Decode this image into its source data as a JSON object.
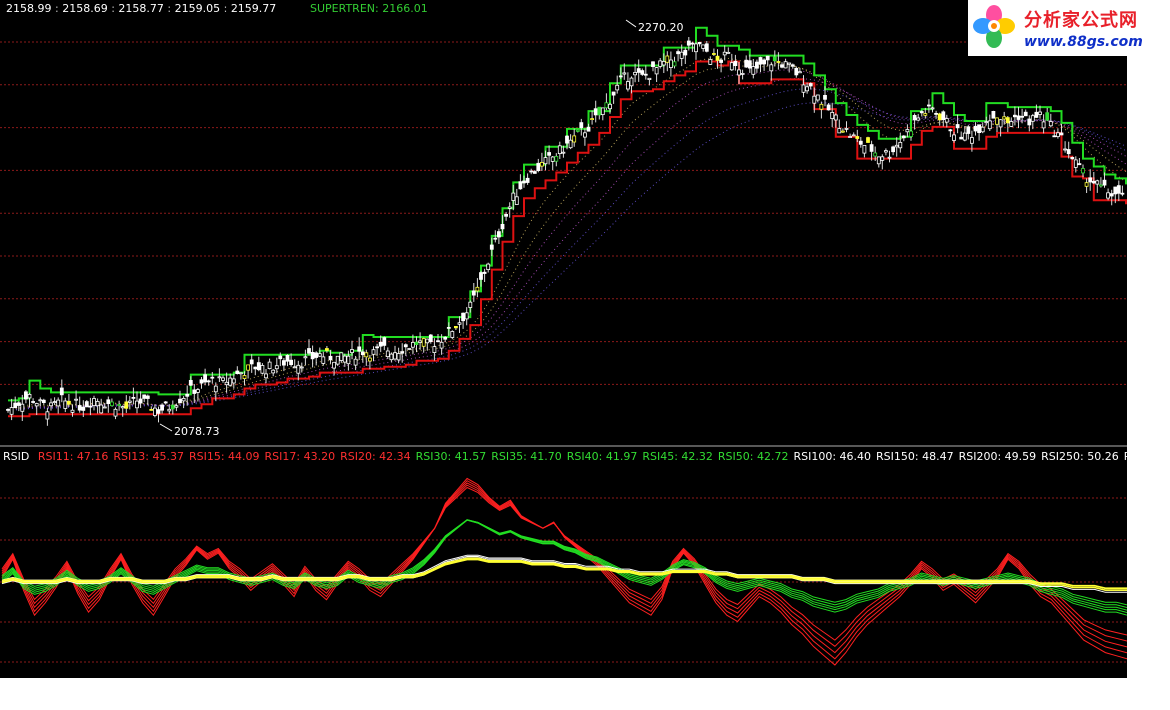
{
  "header": {
    "ohlc": [
      "2158.99",
      "2158.69",
      "2158.77",
      "2159.05",
      "2159.77"
    ],
    "ohlc_separator": " : ",
    "supertrend_label": "SUPERTREN: 2166.01"
  },
  "annotations": {
    "high": "2270.20",
    "low": "2078.73"
  },
  "rsi_panel": {
    "name_prefix": "RSID",
    "items": [
      {
        "label": "RSI11: 47.16",
        "color": "#ff3030"
      },
      {
        "label": "RSI13: 45.37",
        "color": "#ff3030"
      },
      {
        "label": "RSI15: 44.09",
        "color": "#ff3030"
      },
      {
        "label": "RSI17: 43.20",
        "color": "#ff3030"
      },
      {
        "label": "RSI20: 42.34",
        "color": "#ff3030"
      },
      {
        "label": "RSI30: 41.57",
        "color": "#33dd33"
      },
      {
        "label": "RSI35: 41.70",
        "color": "#33dd33"
      },
      {
        "label": "RSI40: 41.97",
        "color": "#33dd33"
      },
      {
        "label": "RSI45: 42.32",
        "color": "#33dd33"
      },
      {
        "label": "RSI50: 42.72",
        "color": "#33dd33"
      },
      {
        "label": "RSI100: 46.40",
        "color": "#ffffff"
      },
      {
        "label": "RSI150: 48.47",
        "color": "#ffffff"
      },
      {
        "label": "RSI200: 49.59",
        "color": "#ffffff"
      },
      {
        "label": "RSI250: 50.26",
        "color": "#ffffff"
      },
      {
        "label": "R",
        "color": "#ffffff"
      }
    ]
  },
  "logo": {
    "title": "分析家公式网",
    "url": "www.88gs.com"
  },
  "colors": {
    "background": "#000000",
    "gridline": "#8b1a1a",
    "up_candle": "#ffffff",
    "down_candle": "#ffffff",
    "strong_up": "#ffff33",
    "strong_down": "#33dd33",
    "supertrend_upper": "#22dd22",
    "supertrend_lower": "#dd1111",
    "ribbon": "#a040c0",
    "rsi_short": "#ff2020",
    "rsi_mid": "#22dd22",
    "rsi_long": "#ffffff",
    "rsi_longest": "#ffff33"
  },
  "chart_data": [
    {
      "type": "candlestick",
      "title": "",
      "ylim": [
        2068,
        2285
      ],
      "grid": true,
      "legend_position": "top-left",
      "close": [
        2083,
        2087,
        2090,
        2086,
        2084,
        2088,
        2086,
        2085,
        2089,
        2087,
        2086,
        2084,
        2088,
        2086,
        2083,
        2085,
        2089,
        2093,
        2095,
        2098,
        2097,
        2100,
        2103,
        2105,
        2104,
        2106,
        2108,
        2107,
        2109,
        2111,
        2110,
        2109,
        2111,
        2113,
        2112,
        2114,
        2113,
        2115,
        2117,
        2116,
        2118,
        2122,
        2128,
        2135,
        2148,
        2163,
        2177,
        2190,
        2199,
        2204,
        2208,
        2212,
        2217,
        2222,
        2226,
        2232,
        2240,
        2249,
        2253,
        2251,
        2254,
        2258,
        2261,
        2263,
        2268,
        2264,
        2259,
        2262,
        2257,
        2254,
        2256,
        2259,
        2258,
        2255,
        2250,
        2244,
        2237,
        2230,
        2224,
        2219,
        2216,
        2212,
        2213,
        2219,
        2226,
        2233,
        2235,
        2230,
        2224,
        2221,
        2224,
        2230,
        2232,
        2228,
        2232,
        2229,
        2232,
        2226,
        2220,
        2210,
        2202,
        2198,
        2194,
        2192,
        2189
      ]
    },
    {
      "type": "line",
      "title": "",
      "ylim": [
        15,
        90
      ],
      "grid": true,
      "series": [
        {
          "name": "RSI11",
          "values": [
            52,
            58,
            48,
            40,
            44,
            49,
            55,
            47,
            41,
            45,
            52,
            58,
            50,
            44,
            40,
            46,
            52,
            56,
            61,
            58,
            60,
            55,
            52,
            48,
            51,
            54,
            50,
            46,
            53,
            48,
            45,
            50,
            55,
            52,
            48,
            46,
            50,
            54,
            58,
            63,
            68,
            76,
            80,
            84,
            82,
            78,
            75,
            77,
            72,
            70,
            68,
            70,
            65,
            62,
            59,
            56,
            52,
            48,
            44,
            42,
            40,
            45,
            55,
            60,
            56,
            50,
            44,
            40,
            38,
            42,
            46,
            44,
            41,
            37,
            34,
            30,
            27,
            24,
            28,
            33,
            37,
            40,
            43,
            46,
            50,
            55,
            52,
            48,
            50,
            47,
            44,
            48,
            52,
            58,
            55,
            50,
            46,
            44,
            40,
            36,
            32,
            30,
            28,
            27,
            26
          ]
        },
        {
          "name": "RSI30",
          "values": [
            50,
            53,
            48,
            46,
            47,
            49,
            52,
            49,
            47,
            48,
            50,
            53,
            50,
            47,
            46,
            48,
            50,
            52,
            54,
            53,
            53,
            51,
            50,
            49,
            50,
            51,
            49,
            48,
            51,
            49,
            48,
            49,
            52,
            50,
            49,
            48,
            50,
            51,
            53,
            56,
            60,
            65,
            68,
            71,
            70,
            68,
            66,
            67,
            65,
            64,
            63,
            63,
            61,
            60,
            58,
            57,
            55,
            53,
            51,
            50,
            49,
            51,
            54,
            56,
            55,
            53,
            50,
            48,
            47,
            48,
            49,
            48,
            47,
            45,
            44,
            42,
            41,
            40,
            41,
            43,
            44,
            45,
            47,
            48,
            49,
            51,
            50,
            49,
            50,
            49,
            48,
            49,
            50,
            51,
            50,
            49,
            47,
            46,
            45,
            43,
            42,
            41,
            40,
            40,
            39
          ]
        },
        {
          "name": "RSI100",
          "values": [
            49,
            50,
            49,
            49,
            49,
            49,
            50,
            49,
            49,
            49,
            50,
            50,
            50,
            49,
            49,
            49,
            50,
            50,
            51,
            51,
            51,
            51,
            50,
            50,
            50,
            51,
            50,
            50,
            50,
            50,
            50,
            50,
            51,
            51,
            50,
            50,
            50,
            51,
            51,
            52,
            54,
            56,
            57,
            58,
            58,
            57,
            57,
            57,
            57,
            56,
            56,
            56,
            55,
            55,
            54,
            54,
            54,
            53,
            53,
            52,
            52,
            52,
            53,
            53,
            53,
            53,
            52,
            52,
            51,
            51,
            51,
            51,
            51,
            51,
            50,
            50,
            50,
            49,
            49,
            49,
            49,
            49,
            49,
            49,
            49,
            49,
            49,
            49,
            49,
            49,
            49,
            49,
            49,
            49,
            49,
            49,
            48,
            48,
            48,
            47,
            47,
            47,
            46,
            46,
            46
          ]
        }
      ]
    }
  ]
}
